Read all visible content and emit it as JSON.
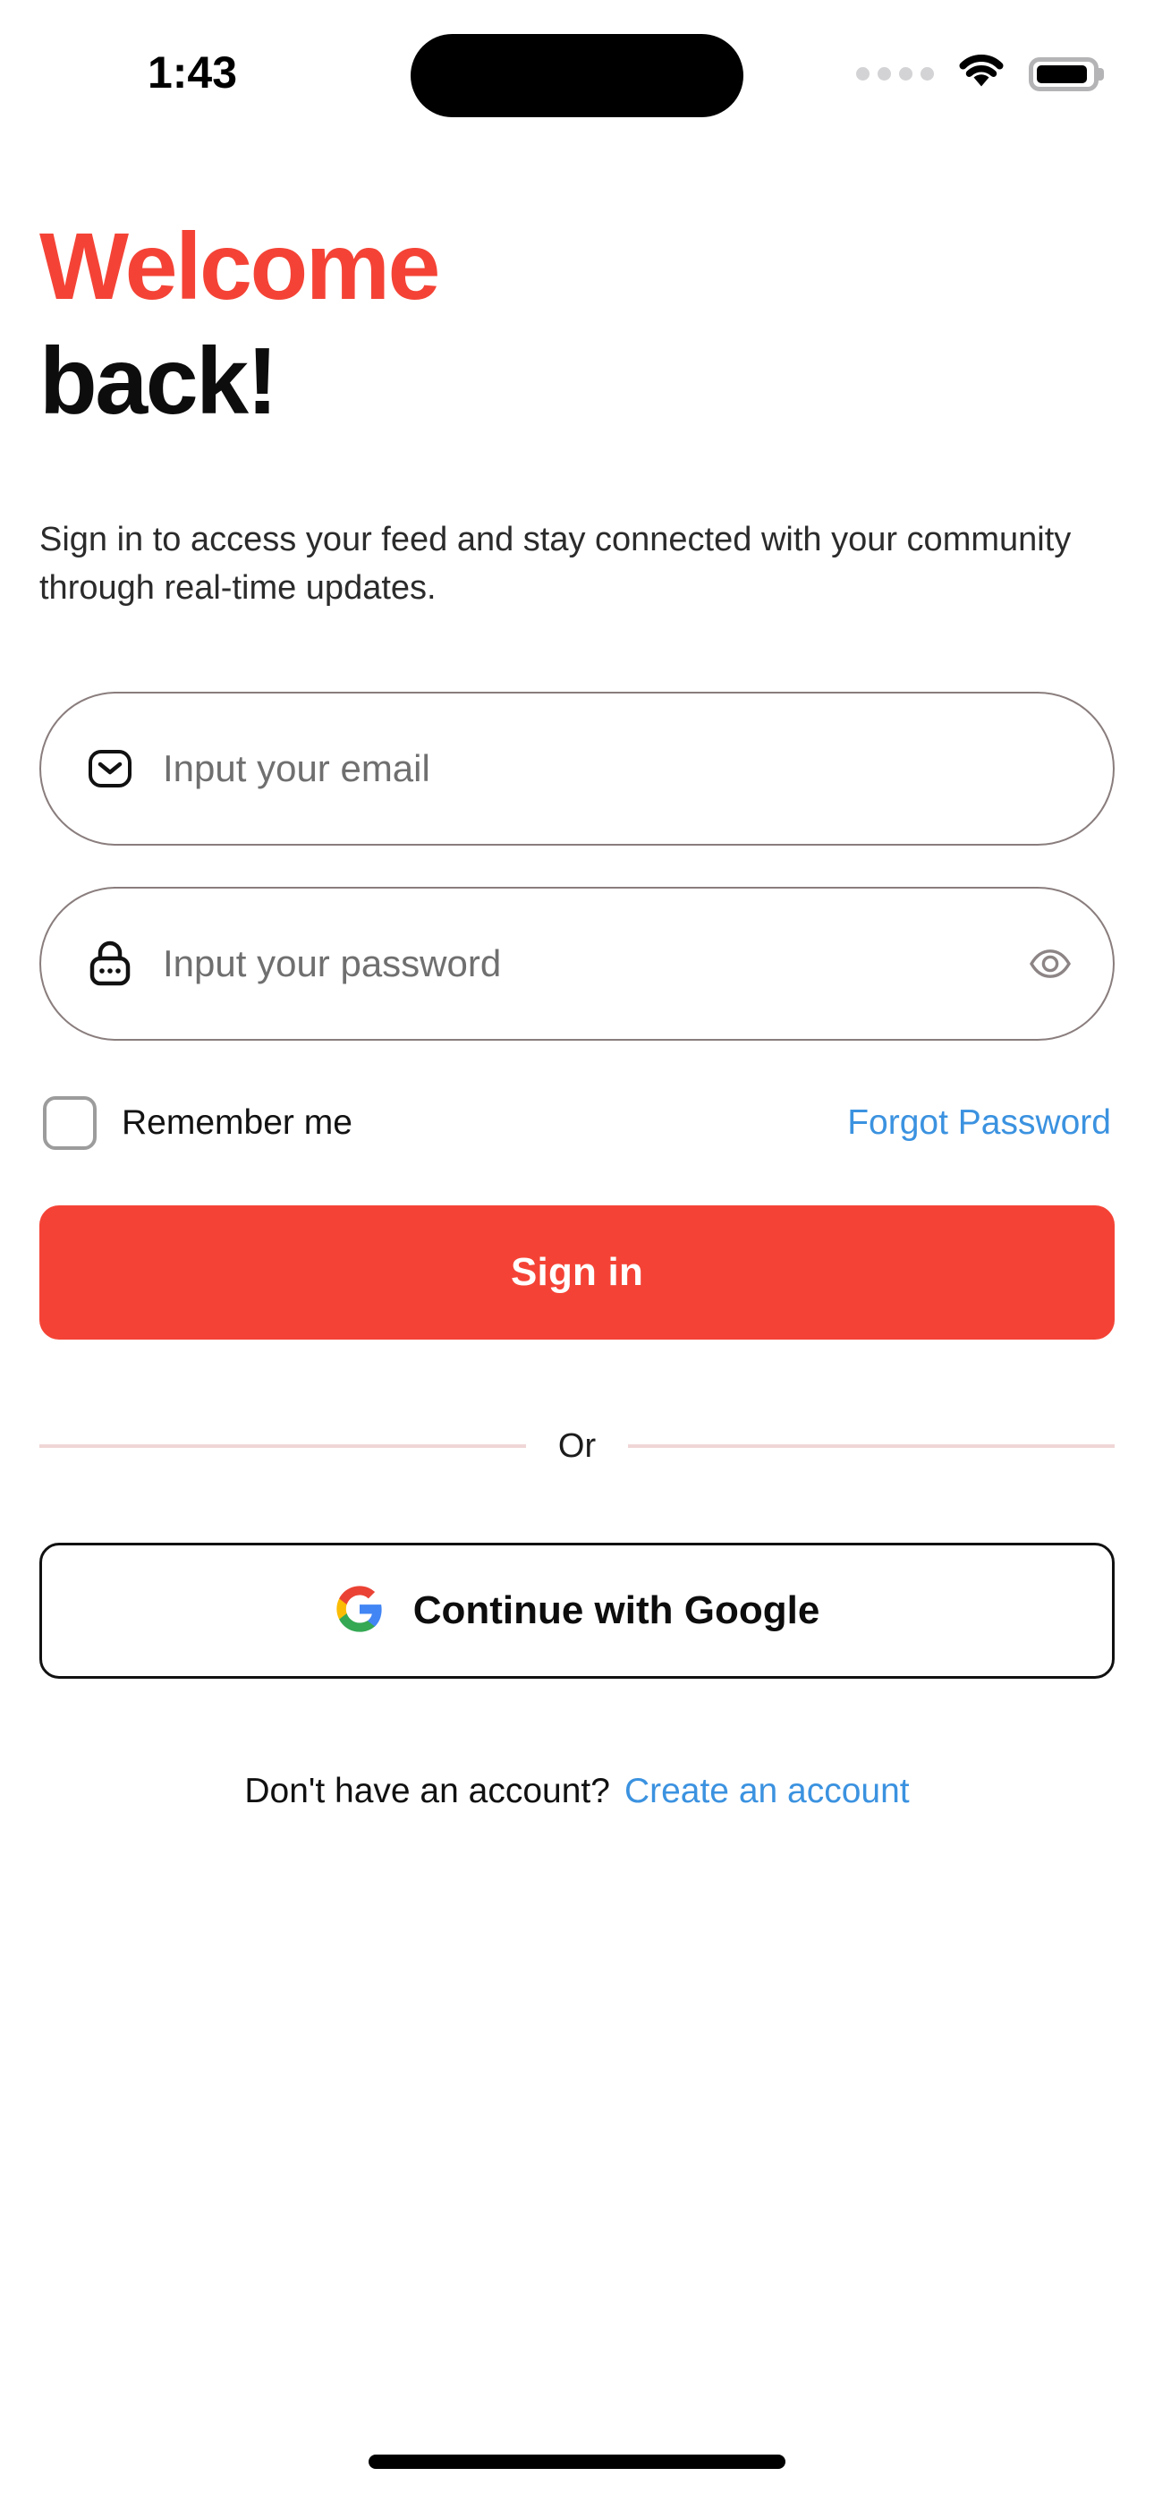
{
  "status_bar": {
    "time": "1:43",
    "signal_icon": "signal-dots-icon",
    "wifi_icon": "wifi-icon",
    "battery_icon": "battery-icon"
  },
  "header": {
    "title_line_1": "Welcome",
    "title_line_2": "back!",
    "subtitle": "Sign in to access your feed and stay connected with your community through real-time updates."
  },
  "form": {
    "email": {
      "value": "",
      "placeholder": "Input your email",
      "icon": "envelope-icon"
    },
    "password": {
      "value": "",
      "placeholder": "Input your password",
      "icon": "lock-icon",
      "toggle_icon": "eye-icon"
    },
    "remember_me_label": "Remember me",
    "remember_me_checked": false,
    "forgot_password_label": "Forgot Password",
    "submit_label": "Sign in"
  },
  "divider": {
    "label": "Or"
  },
  "social": {
    "google_label": "Continue with Google",
    "google_icon": "google-g-icon"
  },
  "footer": {
    "prompt": "Don't have an account?",
    "link_label": "Create an account"
  },
  "colors": {
    "accent_red": "#F44336",
    "link_blue": "#3B92E0",
    "divider_pink": "#F0D6D6",
    "field_border": "#8A7D7D",
    "text_dark": "#0D0D0D",
    "placeholder_gray": "#6F6F6F"
  }
}
